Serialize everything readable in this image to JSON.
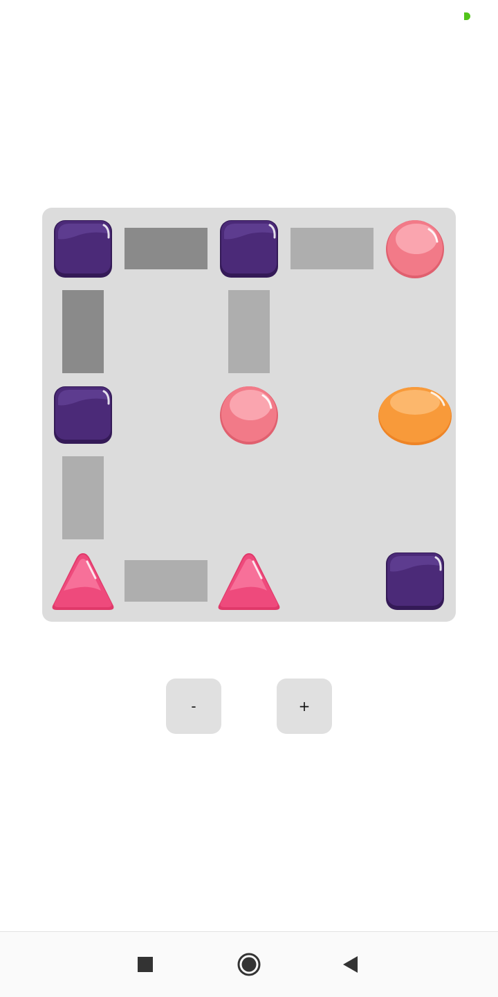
{
  "status_bar": {
    "indicator_color": "#52c41a"
  },
  "board": {
    "background_color": "#dcdcdc",
    "pieces": [
      {
        "row": 0,
        "col": 0,
        "shape": "square",
        "color": "purple"
      },
      {
        "row": 0,
        "col": 2,
        "shape": "square",
        "color": "purple"
      },
      {
        "row": 0,
        "col": 4,
        "shape": "circle",
        "color": "pink"
      },
      {
        "row": 2,
        "col": 0,
        "shape": "square",
        "color": "purple"
      },
      {
        "row": 2,
        "col": 2,
        "shape": "circle",
        "color": "pink"
      },
      {
        "row": 2,
        "col": 4,
        "shape": "oval",
        "color": "orange"
      },
      {
        "row": 4,
        "col": 0,
        "shape": "triangle",
        "color": "magenta"
      },
      {
        "row": 4,
        "col": 2,
        "shape": "triangle",
        "color": "magenta"
      },
      {
        "row": 4,
        "col": 4,
        "shape": "square",
        "color": "purple"
      }
    ],
    "connectors": [
      {
        "from": [
          0,
          0
        ],
        "to": [
          0,
          2
        ],
        "tone": "dark"
      },
      {
        "from": [
          0,
          2
        ],
        "to": [
          0,
          4
        ],
        "tone": "light"
      },
      {
        "from": [
          0,
          0
        ],
        "to": [
          2,
          0
        ],
        "tone": "dark"
      },
      {
        "from": [
          0,
          2
        ],
        "to": [
          2,
          2
        ],
        "tone": "light"
      },
      {
        "from": [
          2,
          0
        ],
        "to": [
          4,
          0
        ],
        "tone": "light"
      },
      {
        "from": [
          4,
          0
        ],
        "to": [
          4,
          2
        ],
        "tone": "light"
      }
    ],
    "connector_colors": {
      "dark": "#8a8a8a",
      "light": "#aeaeae"
    },
    "piece_colors": {
      "purple": {
        "base": "#4b2a78",
        "dark": "#341a57",
        "light": "#6e4aa3"
      },
      "pink": {
        "base": "#f27a88",
        "dark": "#e0606f",
        "light": "#ffc2c9"
      },
      "orange": {
        "base": "#f89a3a",
        "dark": "#ee8426",
        "light": "#ffd096"
      },
      "magenta": {
        "base": "#ee4a7c",
        "dark": "#e0396a",
        "light": "#ff8fb0"
      }
    }
  },
  "controls": {
    "zoom_out_label": "-",
    "zoom_in_label": "+"
  },
  "nav_bar": {
    "recents_icon": "square-icon",
    "home_icon": "circle-icon",
    "back_icon": "triangle-back-icon",
    "icon_color": "#333333"
  }
}
